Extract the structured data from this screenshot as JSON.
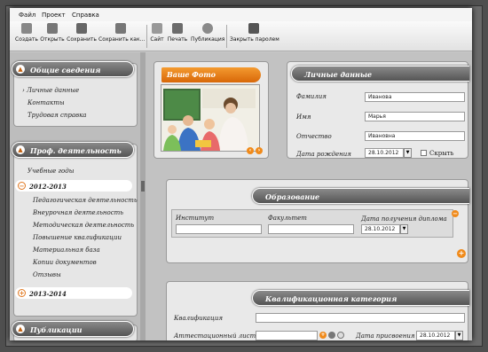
{
  "menu": [
    "Файл",
    "Проект",
    "Справка"
  ],
  "toolbar": [
    {
      "label": "Создать",
      "icon": "new-file-icon"
    },
    {
      "label": "Открыть",
      "icon": "open-folder-icon"
    },
    {
      "label": "Сохранить",
      "icon": "save-icon"
    },
    {
      "label": "Сохранить как...",
      "icon": "save-as-icon"
    },
    {
      "label": "Сайт",
      "icon": "site-icon"
    },
    {
      "label": "Печать",
      "icon": "print-icon"
    },
    {
      "label": "Публикация",
      "icon": "publish-globe-icon"
    },
    {
      "label": "Закрыть паролем",
      "icon": "lock-icon"
    }
  ],
  "sidebar": {
    "general": {
      "title": "Общие сведения",
      "items": [
        "Личные данные",
        "Контакты",
        "Трудовая справка"
      ]
    },
    "prof": {
      "title": "Проф. деятельность",
      "years_label": "Учебные годы",
      "years": [
        "2012-2013",
        "2013-2014"
      ],
      "items": [
        "Педагогическая деятельность",
        "Внеурочная деятельность",
        "Методическая деятельность",
        "Повышение квалификации",
        "Материальная база",
        "Копии документов",
        "Отзывы"
      ]
    },
    "pubs": {
      "title": "Публикации"
    }
  },
  "photo": {
    "title": "Ваше Фото"
  },
  "personal": {
    "title": "Личные данные",
    "surname_label": "Фамилия",
    "surname": "Иванова",
    "name_label": "Имя",
    "name": "Марья",
    "patronymic_label": "Отчество",
    "patronymic": "Ивановна",
    "birth_label": "Дата рождения",
    "birth": "28.10.2012",
    "hide_label": "Скрыть"
  },
  "education": {
    "title": "Образование",
    "institute_label": "Институт",
    "faculty_label": "Факультет",
    "diploma_label": "Дата получения диплома",
    "diploma_date": "28.10.2012"
  },
  "qualification": {
    "title": "Квалификационная категория",
    "qual_label": "Квалификация",
    "sheet_label": "Аттестационный лист",
    "assign_label": "Дата присвоения",
    "assign_date": "28.10.2012"
  },
  "colors": {
    "accent": "#f08a1a",
    "header": "#6a6a6a"
  }
}
